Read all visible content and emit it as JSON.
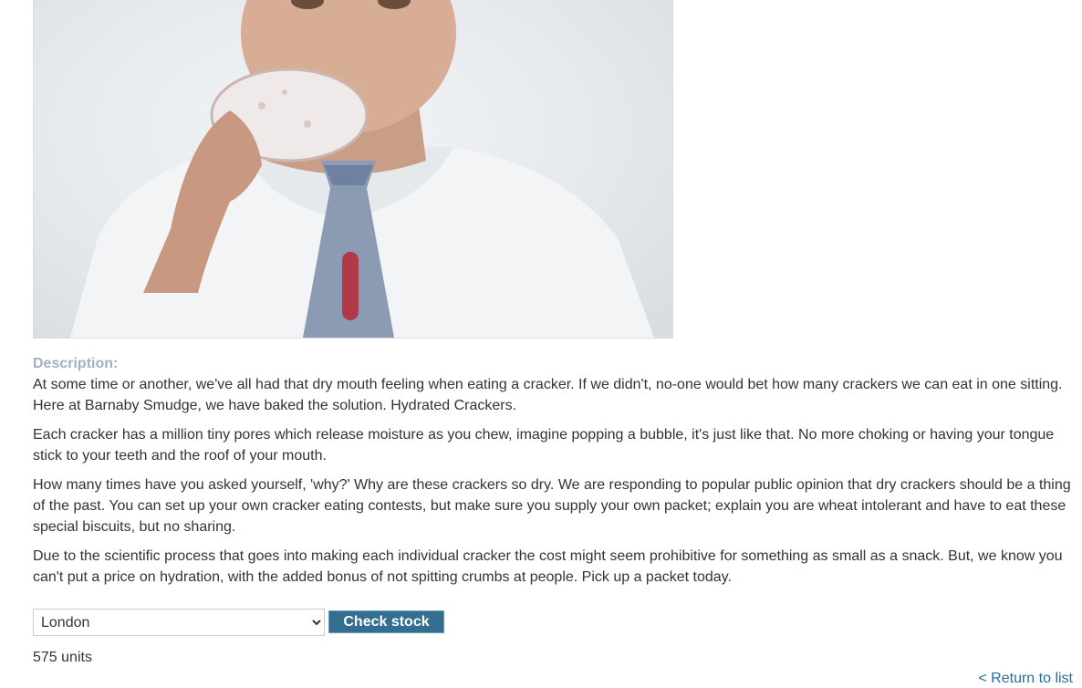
{
  "product": {
    "image_icon": "man-eating-donut-photo"
  },
  "description": {
    "label": "Description:",
    "paragraphs": [
      "At some time or another, we've all had that dry mouth feeling when eating a cracker. If we didn't, no-one would bet how many crackers we can eat in one sitting. Here at Barnaby Smudge, we have baked the solution. Hydrated Crackers.",
      "Each cracker has a million tiny pores which release moisture as you chew, imagine popping a bubble, it's just like that. No more choking or having your tongue stick to your teeth and the roof of your mouth.",
      "How many times have you asked yourself, 'why?' Why are these crackers so dry. We are responding to popular public opinion that dry crackers should be a thing of the past. You can set up your own cracker eating contests, but make sure you supply your own packet; explain you are wheat intolerant and have to eat these special biscuits, but no sharing.",
      "Due to the scientific process that goes into making each individual cracker the cost might seem prohibitive for something as small as a snack. But, we know you can't put a price on hydration, with the added bonus of not spitting crumbs at people. Pick up a packet today."
    ]
  },
  "stock": {
    "selected_store": "London",
    "check_label": "Check stock",
    "result": "575 units"
  },
  "nav": {
    "return_label": "< Return to list"
  },
  "colors": {
    "button_bg": "#336e8f",
    "link": "#286d9a",
    "label": "#a3b1bf"
  }
}
